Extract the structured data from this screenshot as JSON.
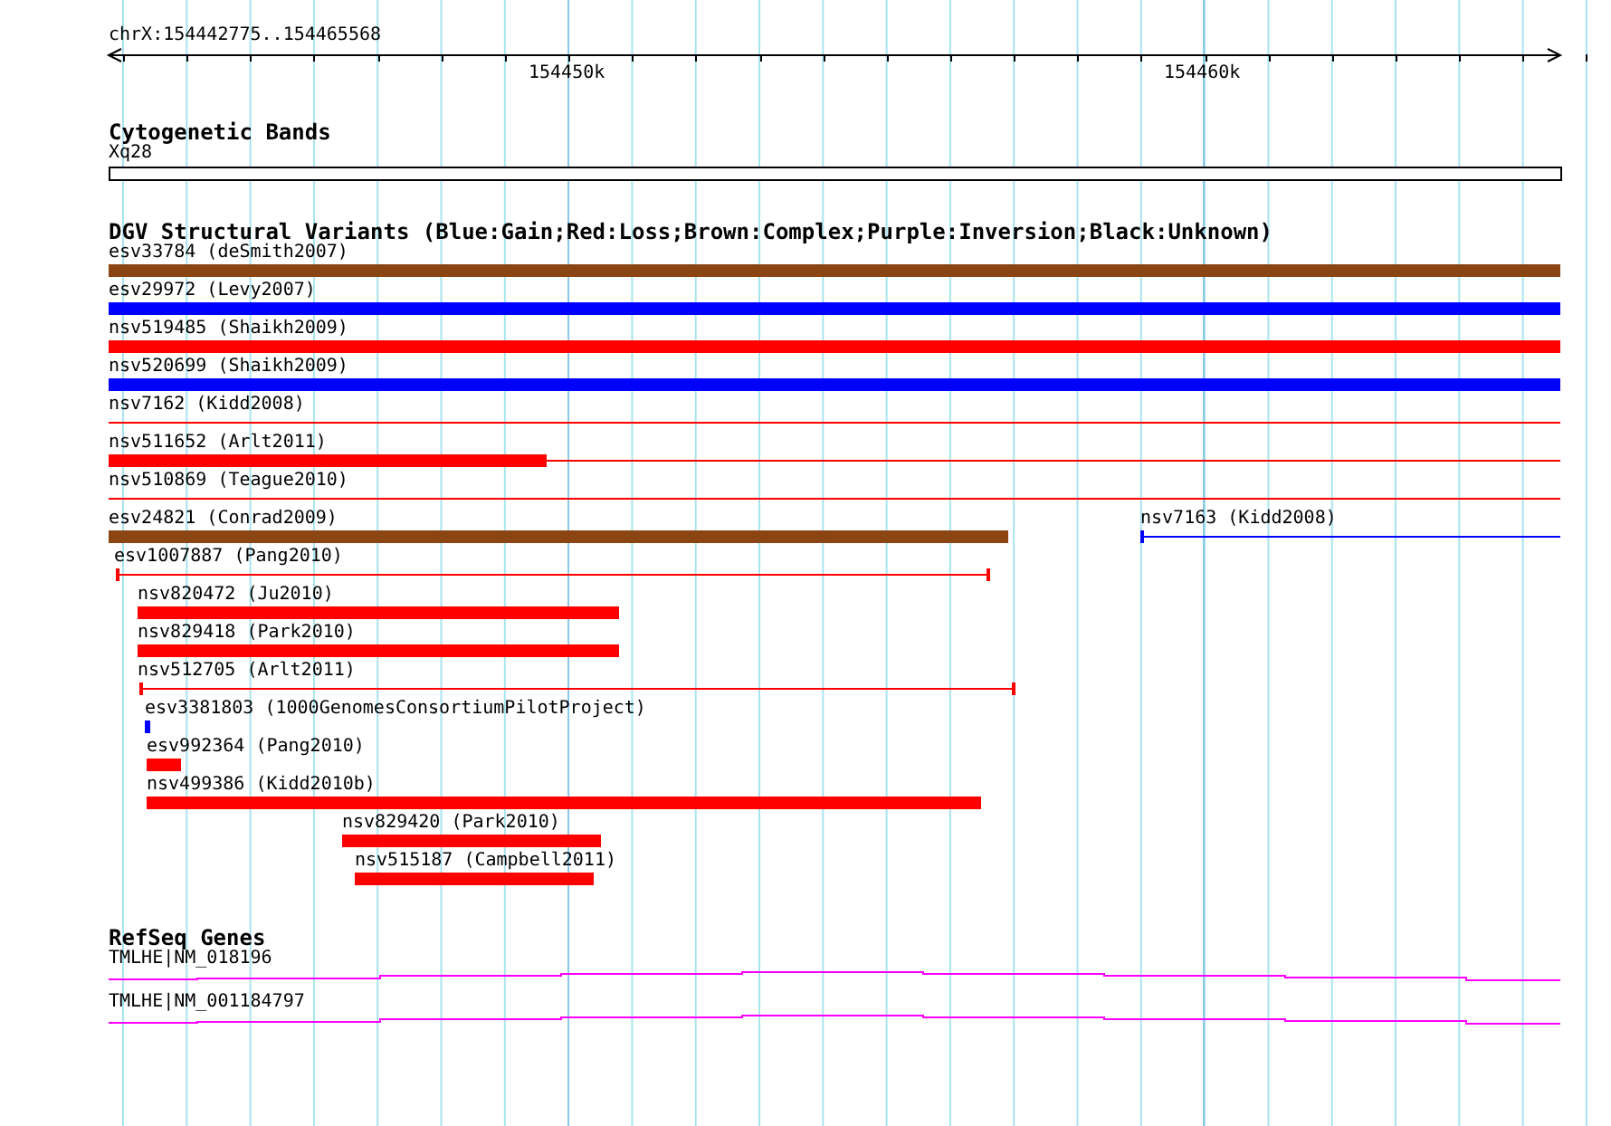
{
  "ruler": {
    "region": "chrX:154442775..154465568",
    "tick_labels": [
      "154450k",
      "154460k"
    ]
  },
  "tracks": [
    {
      "kind": "cytoband",
      "title": "Cytogenetic Bands",
      "features": [
        {
          "label": "Xq28"
        }
      ]
    },
    {
      "kind": "variants",
      "title": "DGV Structural Variants (Blue:Gain;Red:Loss;Brown:Complex;Purple:Inversion;Black:Unknown)",
      "features": [
        {
          "label": "esv33784 (deSmith2007)",
          "color": "#8b4513",
          "kind": "bar"
        },
        {
          "label": "esv29972 (Levy2007)",
          "color": "#0000ff",
          "kind": "bar"
        },
        {
          "label": "nsv519485 (Shaikh2009)",
          "color": "#ff0000",
          "kind": "bar"
        },
        {
          "label": "nsv520699 (Shaikh2009)",
          "color": "#0000ff",
          "kind": "bar"
        },
        {
          "label": "nsv7162 (Kidd2008)",
          "color": "#ff0000",
          "kind": "line"
        },
        {
          "label": "nsv511652 (Arlt2011)",
          "color": "#ff0000",
          "kind": "partial"
        },
        {
          "label": "nsv510869 (Teague2010)",
          "color": "#ff0000",
          "kind": "line"
        },
        {
          "label": "esv24821 (Conrad2009)",
          "color": "#8b4513",
          "kind": "bar"
        },
        {
          "label": "nsv7163 (Kidd2008)",
          "color": "#0000ff",
          "kind": "start-tick"
        },
        {
          "label": "esv1007887 (Pang2010)",
          "color": "#ff0000",
          "kind": "bracket"
        },
        {
          "label": "nsv820472 (Ju2010)",
          "color": "#ff0000",
          "kind": "bar"
        },
        {
          "label": "nsv829418 (Park2010)",
          "color": "#ff0000",
          "kind": "bar"
        },
        {
          "label": "nsv512705 (Arlt2011)",
          "color": "#ff0000",
          "kind": "bracket"
        },
        {
          "label": "esv3381803 (1000GenomesConsortiumPilotProject)",
          "color": "#0000ff",
          "kind": "bar"
        },
        {
          "label": "esv992364 (Pang2010)",
          "color": "#ff0000",
          "kind": "bar"
        },
        {
          "label": "nsv499386 (Kidd2010b)",
          "color": "#ff0000",
          "kind": "bar"
        },
        {
          "label": "nsv829420 (Park2010)",
          "color": "#ff0000",
          "kind": "bar"
        },
        {
          "label": "nsv515187 (Campbell2011)",
          "color": "#ff0000",
          "kind": "bar"
        }
      ]
    },
    {
      "kind": "genes",
      "title": "RefSeq Genes",
      "features": [
        {
          "label": "TMLHE|NM_018196"
        },
        {
          "label": "TMLHE|NM_001184797"
        }
      ]
    }
  ]
}
